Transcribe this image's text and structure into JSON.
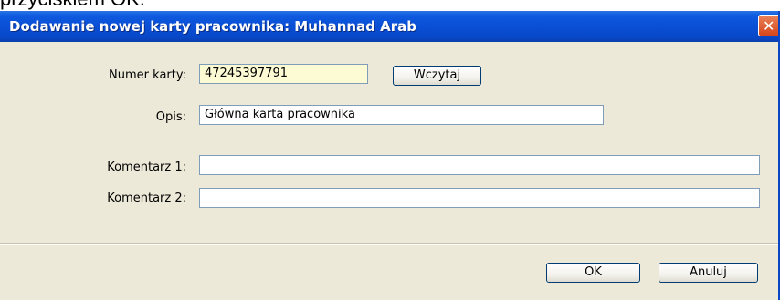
{
  "background": {
    "text": "przyciskiem OK."
  },
  "dialog": {
    "title": "Dodawanie nowej karty pracownika: Muhannad Arab",
    "close_symbol": "✕"
  },
  "form": {
    "card_number_label": "Numer karty:",
    "card_number_value": "47245397791",
    "load_button": "Wczytaj",
    "description_label": "Opis:",
    "description_value": "Główna karta pracownika",
    "comment1_label": "Komentarz 1:",
    "comment1_value": "",
    "comment2_label": "Komentarz 2:",
    "comment2_value": ""
  },
  "footer": {
    "ok_label": "OK",
    "cancel_label": "Anuluj"
  },
  "colors": {
    "titlebar": "#0a4fd6",
    "dialog_bg": "#ece9d8",
    "card_input_bg": "#fdfbd3",
    "close_button": "#d6451a"
  }
}
